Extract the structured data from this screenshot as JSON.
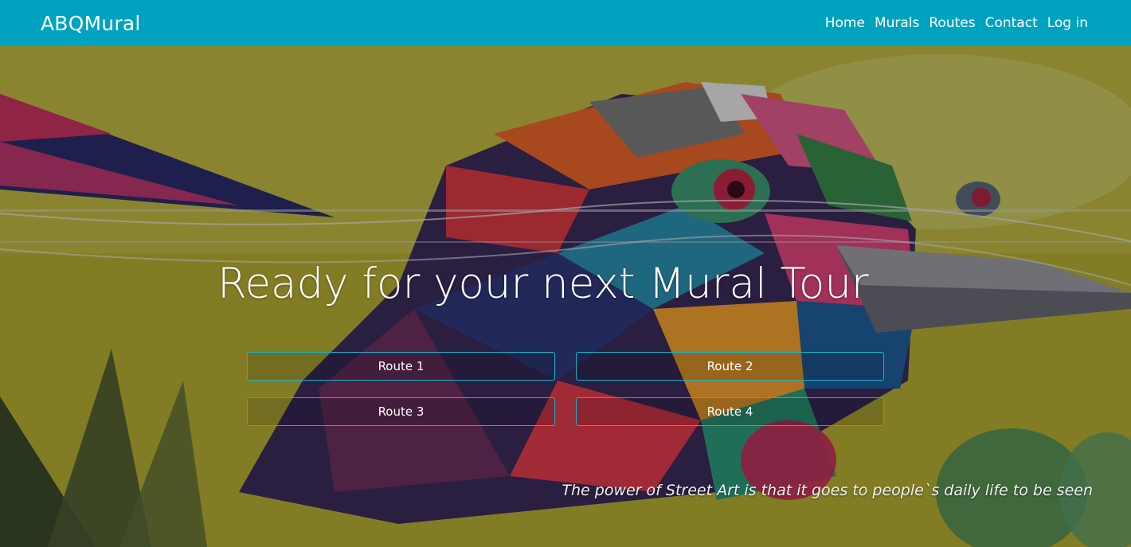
{
  "navbar": {
    "brand": "ABQMural",
    "links": [
      "Home",
      "Murals",
      "Routes",
      "Contact",
      "Log in"
    ],
    "background_color": "#00a3bf"
  },
  "hero": {
    "background_image": "colorful-geometric-bird-mural",
    "title": "Ready for your next Mural Tour",
    "routes": [
      "Route 1",
      "Route 2",
      "Route 3",
      "Route 4"
    ],
    "route_button_border_color": "#17b4cc",
    "quote": "The power of Street Art is that it goes to people`s daily life to be seen"
  }
}
